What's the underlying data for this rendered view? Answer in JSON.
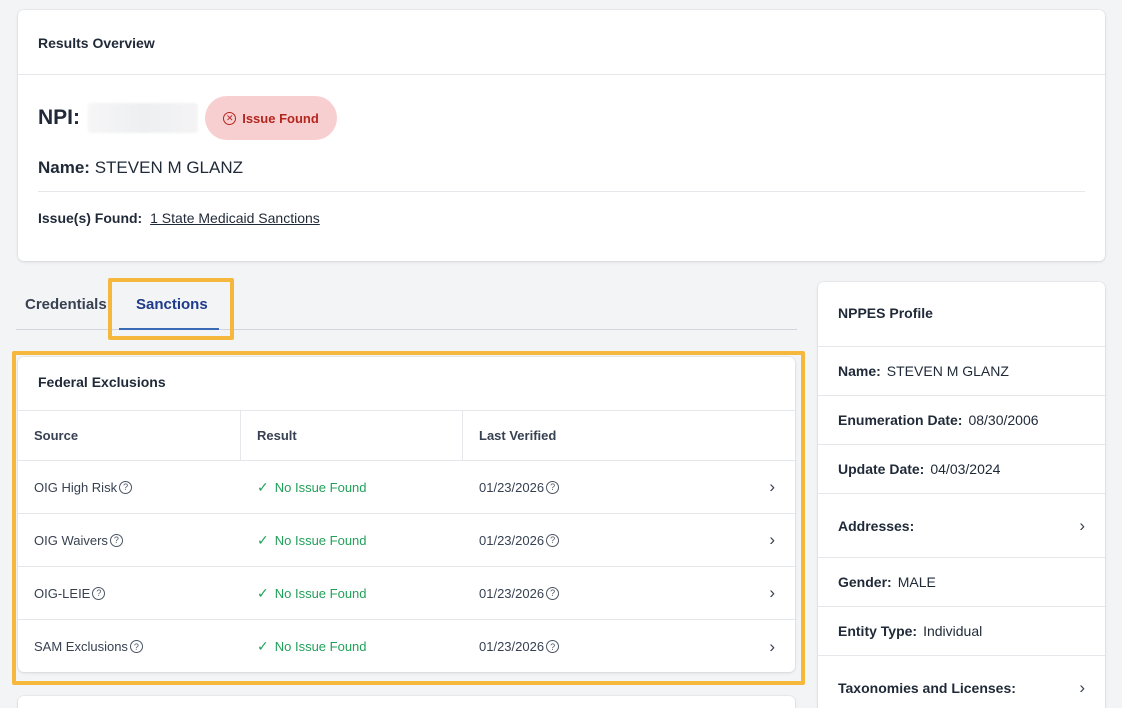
{
  "overview": {
    "title": "Results Overview",
    "npi_label": "NPI:",
    "status_badge": "Issue Found",
    "name_label": "Name:",
    "name_value": "STEVEN M GLANZ",
    "issues_label": "Issue(s) Found:",
    "issues_link": "1 State Medicaid Sanctions"
  },
  "tabs": [
    {
      "label": "Credentials",
      "active": false
    },
    {
      "label": "Sanctions",
      "active": true
    }
  ],
  "federal_exclusions": {
    "title": "Federal Exclusions",
    "columns": [
      "Source",
      "Result",
      "Last Verified"
    ],
    "rows": [
      {
        "source": "OIG High Risk",
        "result": "No Issue Found",
        "last_verified": "01/23/2026"
      },
      {
        "source": "OIG Waivers",
        "result": "No Issue Found",
        "last_verified": "01/23/2026"
      },
      {
        "source": "OIG-LEIE",
        "result": "No Issue Found",
        "last_verified": "01/23/2026"
      },
      {
        "source": "SAM Exclusions",
        "result": "No Issue Found",
        "last_verified": "01/23/2026"
      }
    ]
  },
  "nppes": {
    "title": "NPPES Profile",
    "rows": [
      {
        "label": "Name:",
        "value": "STEVEN M GLANZ"
      },
      {
        "label": "Enumeration Date:",
        "value": "08/30/2006"
      },
      {
        "label": "Update Date:",
        "value": "04/03/2024"
      },
      {
        "label": "Addresses:",
        "value": ""
      },
      {
        "label": "Gender:",
        "value": "MALE"
      },
      {
        "label": "Entity Type:",
        "value": "Individual"
      },
      {
        "label": "Taxonomies and Licenses:",
        "value": ""
      }
    ]
  },
  "colors": {
    "highlight": "#f5b83d",
    "success": "#22a05a",
    "error": "#b3261e",
    "error_bg": "#f8cfd0",
    "tab_active": "#1e3a8a"
  },
  "icons": {
    "status": "circle-x-icon",
    "ok": "check-icon",
    "help": "question-circle-icon",
    "expand": "chevron-right-icon"
  }
}
